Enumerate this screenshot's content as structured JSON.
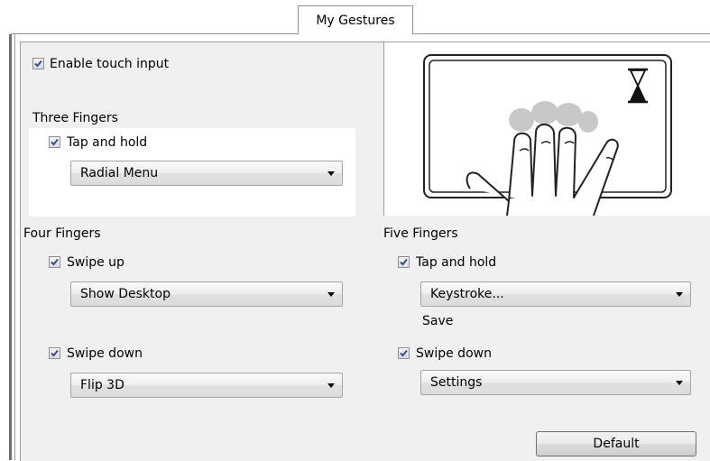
{
  "tab": {
    "label": "My Gestures"
  },
  "enable_touch": {
    "label": "Enable touch input",
    "checked": true
  },
  "three_fingers": {
    "heading": "Three Fingers",
    "tap_hold": {
      "label": "Tap and hold",
      "checked": true,
      "selected": "Radial Menu"
    }
  },
  "four_fingers": {
    "heading": "Four Fingers",
    "swipe_up": {
      "label": "Swipe up",
      "checked": true,
      "selected": "Show Desktop"
    },
    "swipe_down": {
      "label": "Swipe down",
      "checked": true,
      "selected": "Flip 3D"
    }
  },
  "five_fingers": {
    "heading": "Five Fingers",
    "tap_hold": {
      "label": "Tap and hold",
      "checked": true,
      "selected": "Keystroke...",
      "note": "Save"
    },
    "swipe_down": {
      "label": "Swipe down",
      "checked": true,
      "selected": "Settings"
    }
  },
  "default_button": {
    "label": "Default"
  },
  "preview": {
    "icons": [
      "hourglass-icon",
      "hand-gesture-icon"
    ]
  },
  "colors": {
    "panel": "#f0f0f0",
    "check": "#2a4fa8",
    "finger_highlight": "#c8c8c8"
  }
}
